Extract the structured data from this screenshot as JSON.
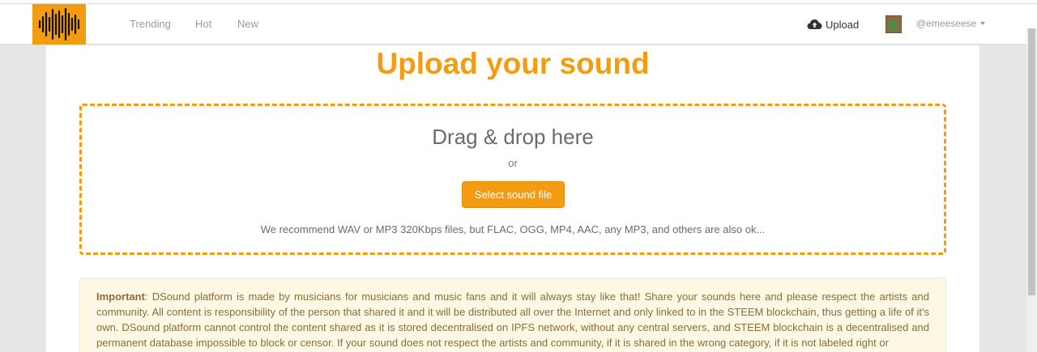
{
  "nav": {
    "logo_name": "dsound-waveform-logo",
    "links": [
      "Trending",
      "Hot",
      "New"
    ],
    "upload_label": "Upload",
    "username": "@emeeseese"
  },
  "main": {
    "title": "Upload your sound",
    "dropzone": {
      "title": "Drag & drop here",
      "or": "or",
      "button_label": "Select sound file",
      "hint": "We recommend WAV or MP3 320Kbps files, but FLAC, OGG, MP4, AAC, any MP3, and others are also ok..."
    },
    "notice": {
      "lead": "Important",
      "text": ": DSound platform is made by musicians for musicians and music fans and it will always stay like that! Share your sounds here and please respect the artists and community. All content is responsibility of the person that shared it and it will be distributed all over the Internet and only linked to in the STEEM blockchain, thus getting a life of it's own. DSound platform cannot control the content shared as it is stored decentralised on IPFS network, without any central servers, and STEEM blockchain is a decentralised and permanent database impossible to block or censor. If your sound does not respect the artists and community, if it is shared in the wrong category, if it is not labeled right or"
    }
  },
  "colors": {
    "accent": "#f39c12",
    "notice_bg": "#fcf8e3",
    "notice_text": "#8a6d3b"
  }
}
